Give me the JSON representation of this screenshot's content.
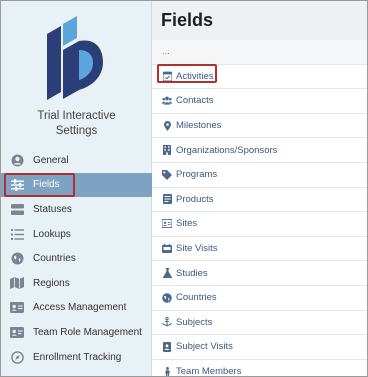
{
  "sidebar": {
    "app_title_line1": "Trial Interactive",
    "app_title_line2": "Settings",
    "logo_colors": {
      "dark": "#2c3e78",
      "light": "#5ba4dc"
    },
    "items": [
      {
        "label": "General",
        "icon": "user-circle-icon"
      },
      {
        "label": "Fields",
        "icon": "sliders-icon",
        "active": true
      },
      {
        "label": "Statuses",
        "icon": "toggle-icon"
      },
      {
        "label": "Lookups",
        "icon": "list-icon"
      },
      {
        "label": "Countries",
        "icon": "globe-icon"
      },
      {
        "label": "Regions",
        "icon": "map-icon"
      },
      {
        "label": "Access Management",
        "icon": "id-card-icon"
      },
      {
        "label": "Team Role Management",
        "icon": "id-badge-icon"
      },
      {
        "label": "Enrollment Tracking",
        "icon": "compass-icon"
      }
    ]
  },
  "main": {
    "title": "Fields",
    "fields": [
      {
        "label": "...",
        "icon": ""
      },
      {
        "label": "Activities",
        "icon": "calendar-check-icon"
      },
      {
        "label": "Contacts",
        "icon": "users-icon"
      },
      {
        "label": "Milestones",
        "icon": "map-pin-icon"
      },
      {
        "label": "Organizations/Sponsors",
        "icon": "building-icon"
      },
      {
        "label": "Programs",
        "icon": "tag-icon"
      },
      {
        "label": "Products",
        "icon": "box-icon"
      },
      {
        "label": "Sites",
        "icon": "address-card-icon"
      },
      {
        "label": "Site Visits",
        "icon": "car-icon"
      },
      {
        "label": "Studies",
        "icon": "flask-icon"
      },
      {
        "label": "Countries",
        "icon": "globe-icon"
      },
      {
        "label": "Subjects",
        "icon": "anchor-icon"
      },
      {
        "label": "Subject Visits",
        "icon": "id-badge-icon"
      },
      {
        "label": "Team Members",
        "icon": "person-icon"
      }
    ]
  },
  "colors": {
    "accent_active": "#7ea2c2",
    "highlight_box": "#b03030",
    "link": "#3a5a80"
  }
}
